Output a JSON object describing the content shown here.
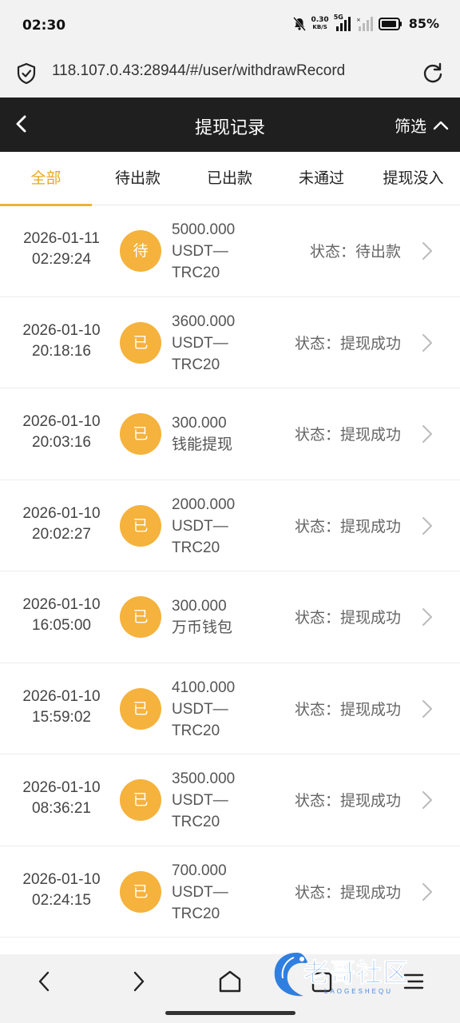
{
  "status_bar": {
    "time": "02:30",
    "net_speed": "0.30",
    "net_unit": "KB/S",
    "network": "5G",
    "battery": "85%"
  },
  "browser": {
    "url": "118.107.0.43:28944/#/user/withdrawRecord"
  },
  "header": {
    "title": "提现记录",
    "filter_label": "筛选"
  },
  "tabs": [
    {
      "label": "全部",
      "active": true
    },
    {
      "label": "待出款",
      "active": false
    },
    {
      "label": "已出款",
      "active": false
    },
    {
      "label": "未通过",
      "active": false
    },
    {
      "label": "提现没入",
      "active": false
    }
  ],
  "records": [
    {
      "date": "2026-01-11",
      "time": "02:29:24",
      "badge": "待",
      "amount": "5000.000",
      "method": [
        "USDT—",
        "TRC20"
      ],
      "status": "状态：待出款"
    },
    {
      "date": "2026-01-10",
      "time": "20:18:16",
      "badge": "已",
      "amount": "3600.000",
      "method": [
        "USDT—",
        "TRC20"
      ],
      "status": "状态：提现成功"
    },
    {
      "date": "2026-01-10",
      "time": "20:03:16",
      "badge": "已",
      "amount": "300.000",
      "method": [
        "钱能提现"
      ],
      "status": "状态：提现成功"
    },
    {
      "date": "2026-01-10",
      "time": "20:02:27",
      "badge": "已",
      "amount": "2000.000",
      "method": [
        "USDT—",
        "TRC20"
      ],
      "status": "状态：提现成功"
    },
    {
      "date": "2026-01-10",
      "time": "16:05:00",
      "badge": "已",
      "amount": "300.000",
      "method": [
        "万币钱包"
      ],
      "status": "状态：提现成功"
    },
    {
      "date": "2026-01-10",
      "time": "15:59:02",
      "badge": "已",
      "amount": "4100.000",
      "method": [
        "USDT—",
        "TRC20"
      ],
      "status": "状态：提现成功"
    },
    {
      "date": "2026-01-10",
      "time": "08:36:21",
      "badge": "已",
      "amount": "3500.000",
      "method": [
        "USDT—",
        "TRC20"
      ],
      "status": "状态：提现成功"
    },
    {
      "date": "2026-01-10",
      "time": "02:24:15",
      "badge": "已",
      "amount": "700.000",
      "method": [
        "USDT—",
        "TRC20"
      ],
      "status": "状态：提现成功"
    }
  ],
  "watermark": {
    "text": "老哥社区",
    "sub": "LAOGESHEQU"
  },
  "colors": {
    "accent": "#f0b234",
    "badge": "#f5b23c",
    "header_bg": "#1f1f1f"
  }
}
